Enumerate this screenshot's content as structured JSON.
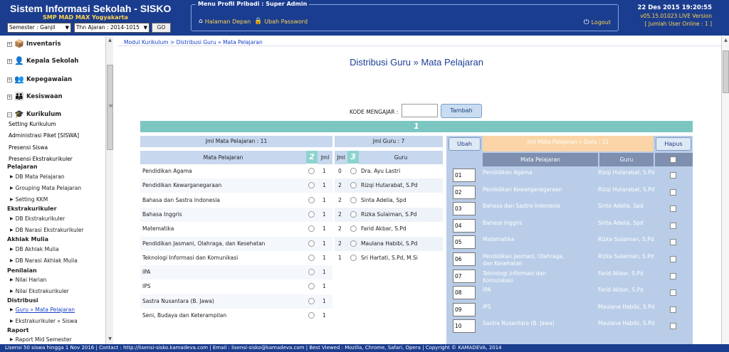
{
  "header": {
    "app_title": "Sistem Informasi Sekolah - SISKO",
    "school_name": "SMP MAD MAX Yogyakarta",
    "semester_select": "Semester : Ganjil",
    "year_select": "Thn Ajaran : 2014-1015",
    "go_label": "GO",
    "menu_legend": "Menu Profil Pribadi : Super Admin",
    "home_link": "Halaman Depan",
    "password_link": "Ubah Password",
    "logout_label": "Logout",
    "datetime": "22 Des 2015 19:20:55",
    "version": "v05.15.01023 LIVE Version",
    "online_users": "[ Jumlah User Online : 1 ]"
  },
  "sidebar": {
    "modules": [
      "Inventaris",
      "Kepala Sekolah",
      "Kepegawaian",
      "Kesiswaan",
      "Kurikulum"
    ],
    "items": [
      "Setting Kurikulum",
      "Administrasi Piket [SISWA]",
      "Presensi Siswa",
      "Presensi Ekstrakurikuler"
    ],
    "sections": [
      {
        "title": "Pelajaran",
        "items": [
          "DB Mata Pelajaran",
          "Grouping Mata Pelajaran",
          "Setting KKM"
        ]
      },
      {
        "title": "Ekstrakurikuler",
        "items": [
          "DB Ekstrakurikuler",
          "DB Narasi Ekstrakurikuler"
        ]
      },
      {
        "title": "Akhlak Mulia",
        "items": [
          "DB Akhlak Mulia",
          "DB Narasi Akhlak Mulia"
        ]
      },
      {
        "title": "Penilaian",
        "items": [
          "Nilai Harian",
          "Nilai Ekstrakurikuler"
        ]
      },
      {
        "title": "Distribusi",
        "items": [
          "Guru » Mata Pelajaran",
          "Ekstrakurikuler » Siswa"
        ]
      },
      {
        "title": "Raport",
        "items": [
          "Raport Mid Semester"
        ]
      }
    ]
  },
  "breadcrumb": "Modul Kurikulum > Distribusi Guru » Mata Pelajaran",
  "page_title": "Distribusi Guru » Mata Pelajaran",
  "form": {
    "kode_label": "KODE MENGAJAR :",
    "tambah_label": "Tambah",
    "step1": "1"
  },
  "mapel_panel": {
    "header": "Jml Mata Pelajaran : 11",
    "col_mapel": "Mata Pelajaran",
    "step": "2",
    "col_jml": "Jml",
    "rows": [
      {
        "name": "Pendidikan Agama",
        "jml": "1"
      },
      {
        "name": "Pendidikan Kewarganegaraan",
        "jml": "1"
      },
      {
        "name": "Bahasa dan Sastra Indonesia",
        "jml": "1"
      },
      {
        "name": "Bahasa Inggris",
        "jml": "1"
      },
      {
        "name": "Matematika",
        "jml": "1"
      },
      {
        "name": "Pendidikan Jasmani, Olahraga, dan Kesehatan",
        "jml": "1"
      },
      {
        "name": "Teknologi Informasi dan Komunikasi",
        "jml": "1"
      },
      {
        "name": "IPA",
        "jml": "1"
      },
      {
        "name": "IPS",
        "jml": "1"
      },
      {
        "name": "Sastra Nusantara (B. Jawa)",
        "jml": "1"
      },
      {
        "name": "Seni, Budaya dan Keterampilan",
        "jml": "1"
      }
    ]
  },
  "guru_panel": {
    "header": "Jml Guru : 7",
    "col_jml": "Jml",
    "step": "3",
    "col_guru": "Guru",
    "rows": [
      {
        "jml": "0",
        "name": "Dra. Ayu Lastri"
      },
      {
        "jml": "2",
        "name": "Rizqi Hutarabat, S.Pd"
      },
      {
        "jml": "2",
        "name": "Sinta Adelia, Spd"
      },
      {
        "jml": "2",
        "name": "Rizka Sulaiman, S.Pd"
      },
      {
        "jml": "2",
        "name": "Farid Akbar, S.Pd"
      },
      {
        "jml": "2",
        "name": "Maulana Habibi, S.Pd"
      },
      {
        "jml": "1",
        "name": "Sri Hartati, S.Pd, M.Si"
      }
    ]
  },
  "dist_panel": {
    "ubah_label": "Ubah",
    "header": "Jml Mata Pelajaran » Guru : 11",
    "hapus_label": "Hapus",
    "col_mapel": "Mata Pelajaran",
    "col_guru": "Guru",
    "rows": [
      {
        "code": "01",
        "mapel": "Pendidikan Agama",
        "guru": "Rizqi Hutarabat, S.Pd"
      },
      {
        "code": "02",
        "mapel": "Pendidikan Kewarganegaraan",
        "guru": "Rizqi Hutarabat, S.Pd"
      },
      {
        "code": "03",
        "mapel": "Bahasa dan Sastra Indonesia",
        "guru": "Sinta Adelia, Spd"
      },
      {
        "code": "04",
        "mapel": "Bahasa Inggris",
        "guru": "Sinta Adelia, Spd"
      },
      {
        "code": "05",
        "mapel": "Matematika",
        "guru": "Rizka Sulaiman, S.Pd"
      },
      {
        "code": "06",
        "mapel": "Pendidikan Jasmani, Olahraga, dan Kesehatan",
        "guru": "Rizka Sulaiman, S.Pd"
      },
      {
        "code": "07",
        "mapel": "Teknologi Informasi dan Komunikasi",
        "guru": "Farid Akbar, S.Pd"
      },
      {
        "code": "08",
        "mapel": "IPA",
        "guru": "Farid Akbar, S.Pd"
      },
      {
        "code": "09",
        "mapel": "IPS",
        "guru": "Maulana Habibi, S.Pd"
      },
      {
        "code": "10",
        "mapel": "Sastra Nusantara (B. Jawa)",
        "guru": "Maulana Habibi, S.Pd"
      }
    ]
  },
  "footer": "Lisensi 50 siswa hingga 1 Nov 2016   |   Contact : http://lisensi-sisko.kamadeva.com   |   Email : lisensi-sisko@kamadeva.com   |   Best Viewed : Mozilla, Chrome, Safari, Opera   |   Copyright © KAMADEVA, 2014"
}
